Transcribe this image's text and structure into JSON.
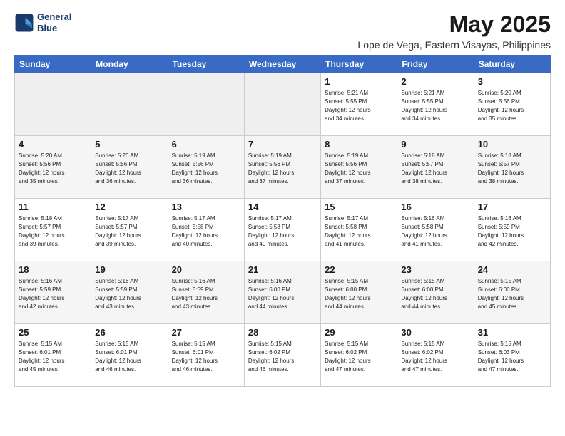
{
  "logo": {
    "line1": "General",
    "line2": "Blue"
  },
  "title": "May 2025",
  "location": "Lope de Vega, Eastern Visayas, Philippines",
  "days_of_week": [
    "Sunday",
    "Monday",
    "Tuesday",
    "Wednesday",
    "Thursday",
    "Friday",
    "Saturday"
  ],
  "weeks": [
    [
      {
        "num": "",
        "info": ""
      },
      {
        "num": "",
        "info": ""
      },
      {
        "num": "",
        "info": ""
      },
      {
        "num": "",
        "info": ""
      },
      {
        "num": "1",
        "info": "Sunrise: 5:21 AM\nSunset: 5:55 PM\nDaylight: 12 hours\nand 34 minutes."
      },
      {
        "num": "2",
        "info": "Sunrise: 5:21 AM\nSunset: 5:55 PM\nDaylight: 12 hours\nand 34 minutes."
      },
      {
        "num": "3",
        "info": "Sunrise: 5:20 AM\nSunset: 5:56 PM\nDaylight: 12 hours\nand 35 minutes."
      }
    ],
    [
      {
        "num": "4",
        "info": "Sunrise: 5:20 AM\nSunset: 5:56 PM\nDaylight: 12 hours\nand 35 minutes."
      },
      {
        "num": "5",
        "info": "Sunrise: 5:20 AM\nSunset: 5:56 PM\nDaylight: 12 hours\nand 36 minutes."
      },
      {
        "num": "6",
        "info": "Sunrise: 5:19 AM\nSunset: 5:56 PM\nDaylight: 12 hours\nand 36 minutes."
      },
      {
        "num": "7",
        "info": "Sunrise: 5:19 AM\nSunset: 5:56 PM\nDaylight: 12 hours\nand 37 minutes."
      },
      {
        "num": "8",
        "info": "Sunrise: 5:19 AM\nSunset: 5:56 PM\nDaylight: 12 hours\nand 37 minutes."
      },
      {
        "num": "9",
        "info": "Sunrise: 5:18 AM\nSunset: 5:57 PM\nDaylight: 12 hours\nand 38 minutes."
      },
      {
        "num": "10",
        "info": "Sunrise: 5:18 AM\nSunset: 5:57 PM\nDaylight: 12 hours\nand 38 minutes."
      }
    ],
    [
      {
        "num": "11",
        "info": "Sunrise: 5:18 AM\nSunset: 5:57 PM\nDaylight: 12 hours\nand 39 minutes."
      },
      {
        "num": "12",
        "info": "Sunrise: 5:17 AM\nSunset: 5:57 PM\nDaylight: 12 hours\nand 39 minutes."
      },
      {
        "num": "13",
        "info": "Sunrise: 5:17 AM\nSunset: 5:58 PM\nDaylight: 12 hours\nand 40 minutes."
      },
      {
        "num": "14",
        "info": "Sunrise: 5:17 AM\nSunset: 5:58 PM\nDaylight: 12 hours\nand 40 minutes."
      },
      {
        "num": "15",
        "info": "Sunrise: 5:17 AM\nSunset: 5:58 PM\nDaylight: 12 hours\nand 41 minutes."
      },
      {
        "num": "16",
        "info": "Sunrise: 5:16 AM\nSunset: 5:58 PM\nDaylight: 12 hours\nand 41 minutes."
      },
      {
        "num": "17",
        "info": "Sunrise: 5:16 AM\nSunset: 5:59 PM\nDaylight: 12 hours\nand 42 minutes."
      }
    ],
    [
      {
        "num": "18",
        "info": "Sunrise: 5:16 AM\nSunset: 5:59 PM\nDaylight: 12 hours\nand 42 minutes."
      },
      {
        "num": "19",
        "info": "Sunrise: 5:16 AM\nSunset: 5:59 PM\nDaylight: 12 hours\nand 43 minutes."
      },
      {
        "num": "20",
        "info": "Sunrise: 5:16 AM\nSunset: 5:59 PM\nDaylight: 12 hours\nand 43 minutes."
      },
      {
        "num": "21",
        "info": "Sunrise: 5:16 AM\nSunset: 6:00 PM\nDaylight: 12 hours\nand 44 minutes."
      },
      {
        "num": "22",
        "info": "Sunrise: 5:15 AM\nSunset: 6:00 PM\nDaylight: 12 hours\nand 44 minutes."
      },
      {
        "num": "23",
        "info": "Sunrise: 5:15 AM\nSunset: 6:00 PM\nDaylight: 12 hours\nand 44 minutes."
      },
      {
        "num": "24",
        "info": "Sunrise: 5:15 AM\nSunset: 6:00 PM\nDaylight: 12 hours\nand 45 minutes."
      }
    ],
    [
      {
        "num": "25",
        "info": "Sunrise: 5:15 AM\nSunset: 6:01 PM\nDaylight: 12 hours\nand 45 minutes."
      },
      {
        "num": "26",
        "info": "Sunrise: 5:15 AM\nSunset: 6:01 PM\nDaylight: 12 hours\nand 46 minutes."
      },
      {
        "num": "27",
        "info": "Sunrise: 5:15 AM\nSunset: 6:01 PM\nDaylight: 12 hours\nand 46 minutes."
      },
      {
        "num": "28",
        "info": "Sunrise: 5:15 AM\nSunset: 6:02 PM\nDaylight: 12 hours\nand 46 minutes."
      },
      {
        "num": "29",
        "info": "Sunrise: 5:15 AM\nSunset: 6:02 PM\nDaylight: 12 hours\nand 47 minutes."
      },
      {
        "num": "30",
        "info": "Sunrise: 5:15 AM\nSunset: 6:02 PM\nDaylight: 12 hours\nand 47 minutes."
      },
      {
        "num": "31",
        "info": "Sunrise: 5:15 AM\nSunset: 6:03 PM\nDaylight: 12 hours\nand 47 minutes."
      }
    ]
  ]
}
